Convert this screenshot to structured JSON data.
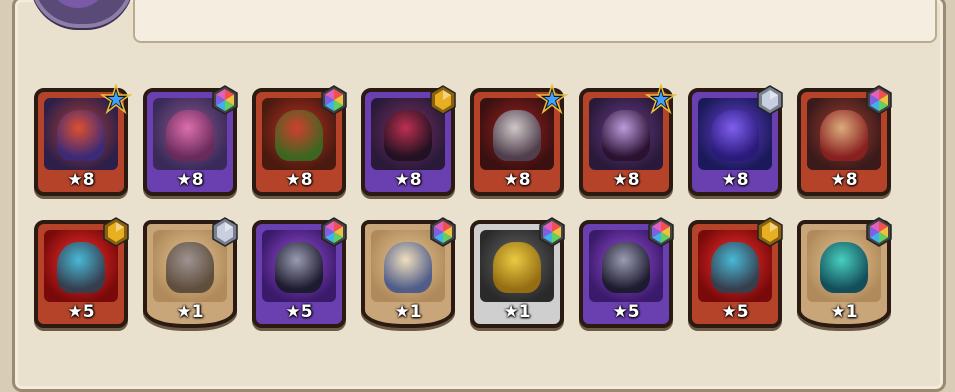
{
  "rewards": {
    "heroes": [
      {
        "level": "★8",
        "rarity": "star-blue",
        "frame": "red",
        "bg": "#2d1f4a",
        "glow": "#b04030",
        "fig1": "#e05030",
        "fig2": "#3a2a7a",
        "icon": "demon-beast"
      },
      {
        "level": "★8",
        "rarity": "rainbow",
        "frame": "purple",
        "bg": "#3a2a5a",
        "glow": "#8a5a8a",
        "fig1": "#e070b0",
        "fig2": "#6a2a5a",
        "icon": "horned-brute"
      },
      {
        "level": "★8",
        "rarity": "rainbow",
        "frame": "red",
        "bg": "#4a1a10",
        "glow": "#c03020",
        "fig1": "#d04030",
        "fig2": "#3a6a20",
        "icon": "fire-dragon"
      },
      {
        "level": "★8",
        "rarity": "gold",
        "frame": "purple",
        "bg": "#2a1a3a",
        "glow": "#7a3060",
        "fig1": "#c03050",
        "fig2": "#201020",
        "icon": "witch"
      },
      {
        "level": "★8",
        "rarity": "star-blue",
        "frame": "red",
        "bg": "#3a1010",
        "glow": "#a02020",
        "fig1": "#d0d0d0",
        "fig2": "#504050",
        "icon": "three-headed-hound"
      },
      {
        "level": "★8",
        "rarity": "star-blue",
        "frame": "red",
        "bg": "#2a1a3a",
        "glow": "#6a3a8a",
        "fig1": "#c0a0e0",
        "fig2": "#2a1030",
        "icon": "vampire"
      },
      {
        "level": "★8",
        "rarity": "silver",
        "frame": "purple",
        "bg": "#1a1a5a",
        "glow": "#6a40d0",
        "fig1": "#8060f0",
        "fig2": "#2a1a7a",
        "icon": "shadow-golem"
      },
      {
        "level": "★8",
        "rarity": "rainbow",
        "frame": "red",
        "bg": "#3a1a1a",
        "glow": "#a04030",
        "fig1": "#e0b080",
        "fig2": "#8a2020",
        "icon": "red-hood-girl"
      }
    ],
    "items": [
      {
        "level": "★5",
        "rarity": "gold",
        "frame": "red",
        "bg": "#7a0a0a",
        "glow": "#ff3030",
        "fig1": "#40c0e0",
        "fig2": "#304050",
        "icon": "spear",
        "shape": "card"
      },
      {
        "level": "★1",
        "rarity": "silver",
        "frame": "tan",
        "bg": "#b08a5a",
        "glow": "#e8c89a",
        "fig1": "#9a9090",
        "fig2": "#5a4a3a",
        "icon": "pickaxe",
        "shape": "shield"
      },
      {
        "level": "★5",
        "rarity": "rainbow",
        "frame": "purple",
        "bg": "#3a1a6a",
        "glow": "#a050e0",
        "fig1": "#9aa0b0",
        "fig2": "#1a1a2a",
        "icon": "spiked-helmet",
        "shape": "card"
      },
      {
        "level": "★1",
        "rarity": "rainbow",
        "frame": "tan",
        "bg": "#b08a5a",
        "glow": "#e8c89a",
        "fig1": "#f0e0c0",
        "fig2": "#4a5a8a",
        "icon": "scales-emblem",
        "shape": "shield"
      },
      {
        "level": "★1",
        "rarity": "rainbow",
        "frame": "gray",
        "bg": "#2a2a2a",
        "glow": "#6a6a6a",
        "fig1": "#f0d040",
        "fig2": "#9a7010",
        "icon": "gold-coin",
        "shape": "card"
      },
      {
        "level": "★5",
        "rarity": "rainbow",
        "frame": "purple",
        "bg": "#3a1a6a",
        "glow": "#a050e0",
        "fig1": "#9aa0b0",
        "fig2": "#1a1a2a",
        "icon": "spiked-helmet",
        "shape": "card"
      },
      {
        "level": "★5",
        "rarity": "gold",
        "frame": "red",
        "bg": "#7a0a0a",
        "glow": "#ff3030",
        "fig1": "#40c0e0",
        "fig2": "#304050",
        "icon": "spear",
        "shape": "card"
      },
      {
        "level": "★1",
        "rarity": "rainbow",
        "frame": "tan",
        "bg": "#b08a5a",
        "glow": "#e8c89a",
        "fig1": "#40d0c0",
        "fig2": "#0a4a5a",
        "icon": "egg",
        "shape": "shield"
      }
    ]
  },
  "colors": {
    "gold_gem": "#e8b020",
    "silver_gem": "#c8d0e0",
    "star_blue_bg": "#1a1a2a",
    "star_blue_fg": "#40a0ff"
  }
}
